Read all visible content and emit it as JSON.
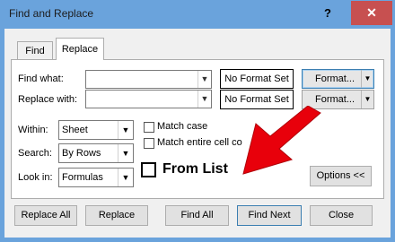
{
  "window": {
    "title": "Find and Replace",
    "help_label": "?",
    "close_label": "✕"
  },
  "tabs": [
    {
      "label": "Find",
      "active": false
    },
    {
      "label": "Replace",
      "active": true
    }
  ],
  "find_what": {
    "label": "Find what:",
    "value": "",
    "preview": "No Format Set",
    "format_button": "Format..."
  },
  "replace_with": {
    "label": "Replace with:",
    "value": "",
    "preview": "No Format Set",
    "format_button": "Format..."
  },
  "within": {
    "label": "Within:",
    "value": "Sheet"
  },
  "search": {
    "label": "Search:",
    "value": "By Rows"
  },
  "look_in": {
    "label": "Look in:",
    "value": "Formulas"
  },
  "match_case": {
    "label": "Match case",
    "checked": false
  },
  "match_entire": {
    "label": "Match entire cell co",
    "checked": false
  },
  "annotation": {
    "label": "From List",
    "arrow_color": "#e8000b"
  },
  "options_button": "Options <<",
  "buttons": {
    "replace_all": "Replace All",
    "replace": "Replace",
    "find_all": "Find All",
    "find_next": "Find Next",
    "close": "Close"
  },
  "colors": {
    "title_bar": "#6aa3dc",
    "close_button": "#c75050",
    "dialog_bg": "#f0f0f0"
  }
}
